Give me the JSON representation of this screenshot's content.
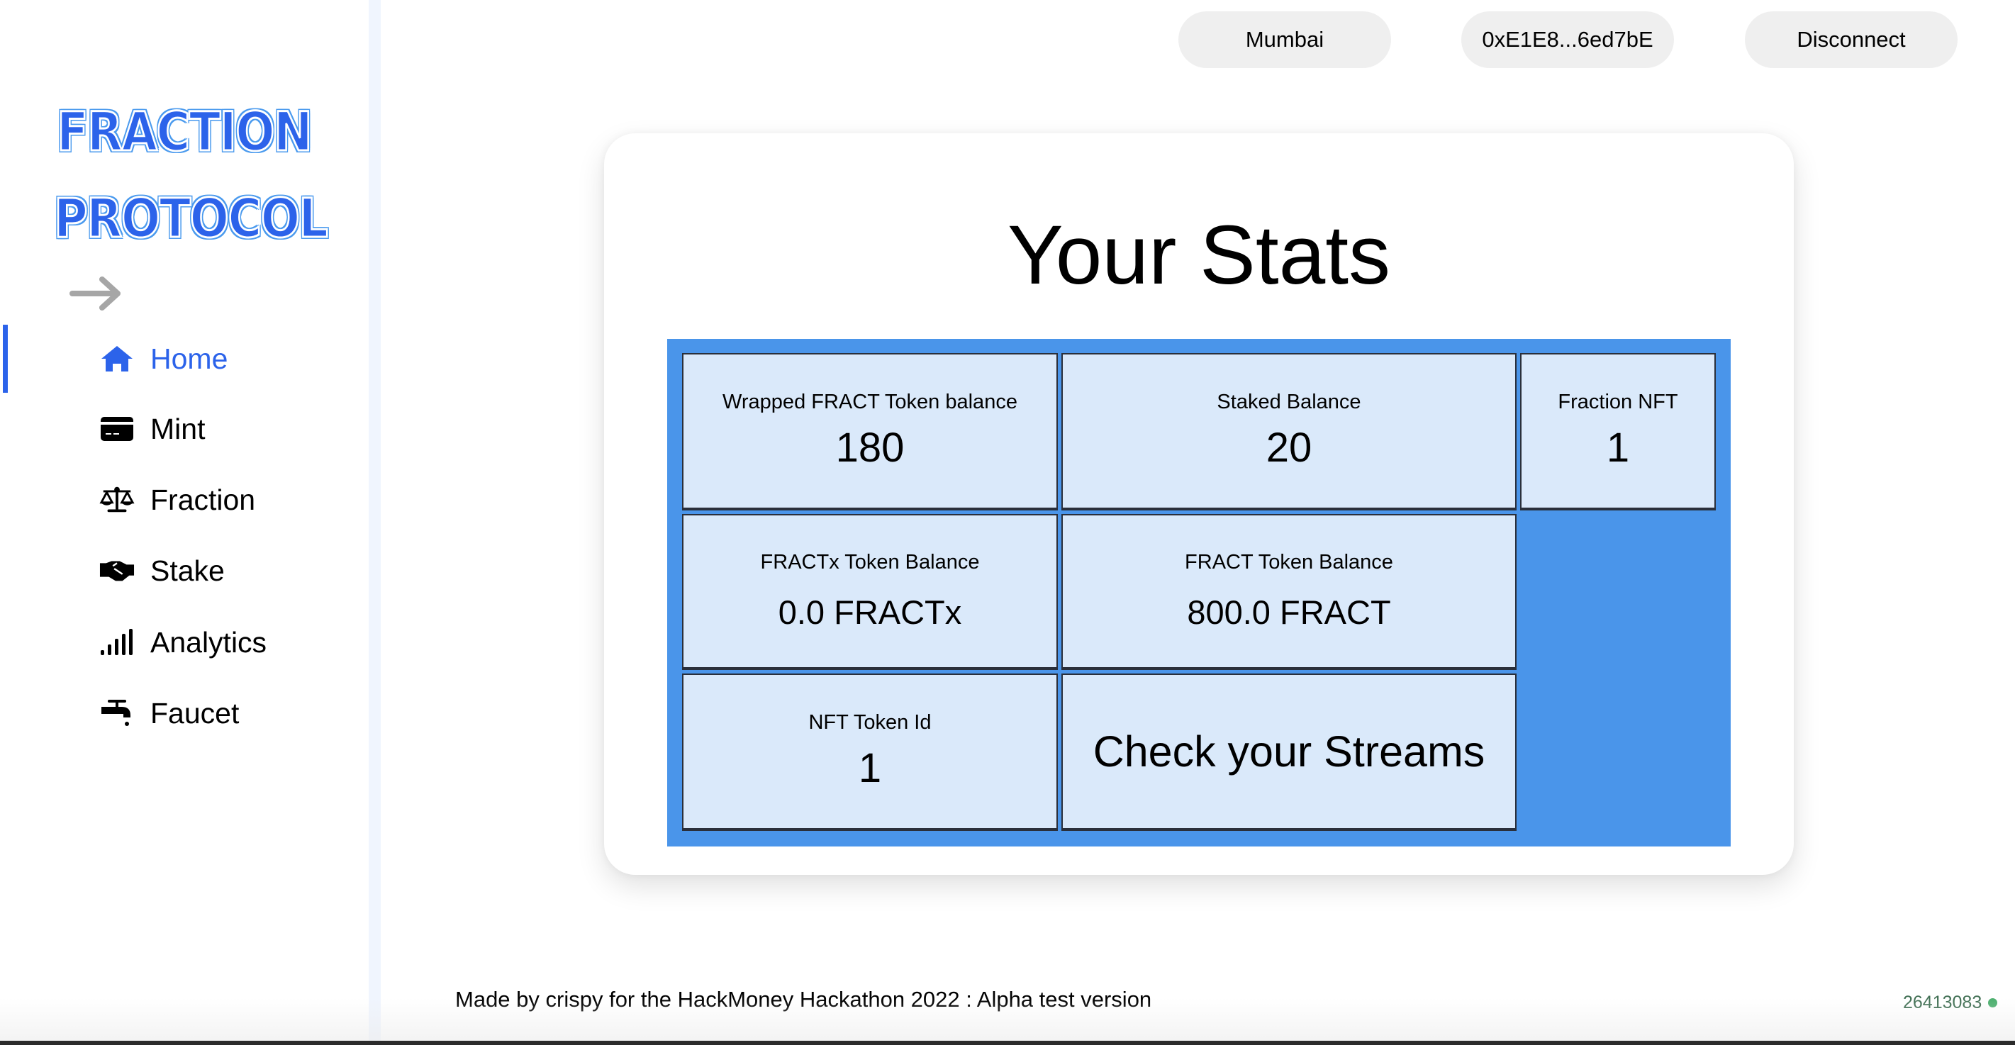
{
  "brand": {
    "line1": "FRACTION",
    "line2": "PROTOCOL",
    "colors": {
      "fill": "#2c63ea",
      "outline": "#4a9aee"
    }
  },
  "sidebar": {
    "collapse_icon": "arrow-right-icon",
    "active_color": "#2c63ea",
    "items": [
      {
        "label": "Home",
        "icon": "home-icon",
        "active": true
      },
      {
        "label": "Mint",
        "icon": "credit-card-icon",
        "active": false
      },
      {
        "label": "Fraction",
        "icon": "scale-icon",
        "active": false
      },
      {
        "label": "Stake",
        "icon": "handshake-icon",
        "active": false
      },
      {
        "label": "Analytics",
        "icon": "signal-bars-icon",
        "active": false
      },
      {
        "label": "Faucet",
        "icon": "faucet-icon",
        "active": false
      }
    ]
  },
  "header": {
    "network_label": "Mumbai",
    "account_label": "0xE1E8...6ed7bE",
    "disconnect_label": "Disconnect"
  },
  "main": {
    "title": "Your Stats",
    "colors": {
      "grid_bg": "#4a95ea",
      "cell_bg": "#dae9fa"
    },
    "stats": {
      "wrapped_fract": {
        "label": "Wrapped FRACT Token balance",
        "value": "180"
      },
      "staked": {
        "label": "Staked Balance",
        "value": "20"
      },
      "fraction_nft": {
        "label": "Fraction NFT",
        "value": "1"
      },
      "fractx": {
        "label": "FRACTx Token Balance",
        "value": "0.0 FRACTx"
      },
      "fract": {
        "label": "FRACT Token Balance",
        "value": "800.0 FRACT"
      },
      "nft_token_id": {
        "label": "NFT Token Id",
        "value": "1"
      }
    },
    "streams_link": "Check your Streams"
  },
  "footer": {
    "text": "Made by crispy for the HackMoney Hackathon 2022 : Alpha test version",
    "block_number": "26413083",
    "status_color": "#4caf6e"
  }
}
